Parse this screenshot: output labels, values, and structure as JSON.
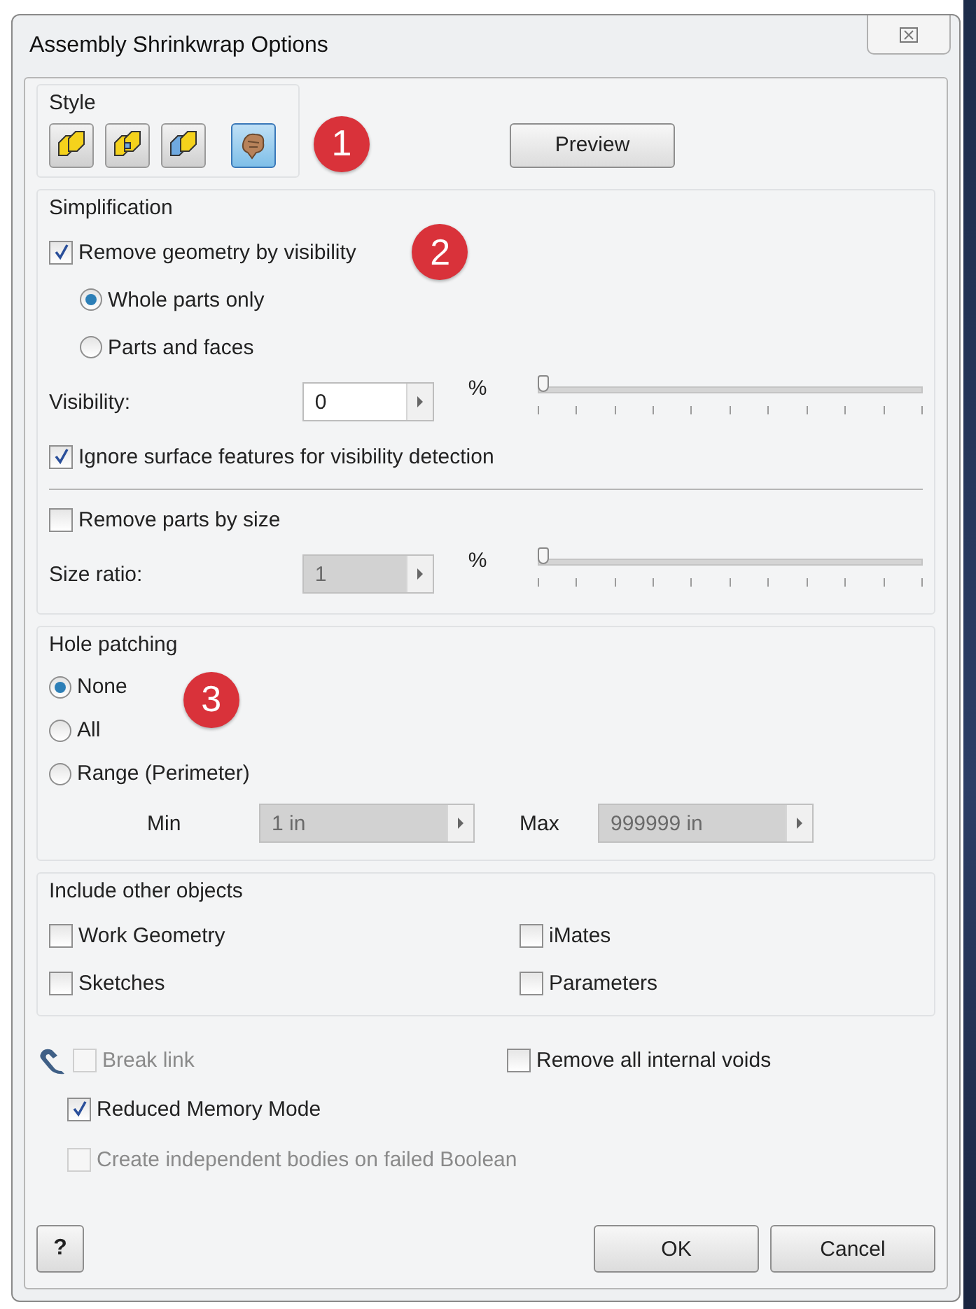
{
  "window": {
    "title": "Assembly Shrinkwrap Options"
  },
  "style": {
    "label": "Style",
    "options": [
      {
        "selected": false
      },
      {
        "selected": false
      },
      {
        "selected": false
      },
      {
        "selected": true
      }
    ],
    "badge": "1",
    "preview": "Preview"
  },
  "simplification": {
    "label": "Simplification",
    "remove_by_visibility": {
      "label": "Remove geometry by visibility",
      "checked": true
    },
    "badge": "2",
    "mode": [
      {
        "label": "Whole parts only",
        "selected": true
      },
      {
        "label": "Parts and faces",
        "selected": false
      }
    ],
    "visibility": {
      "label": "Visibility:",
      "value": "0",
      "unit": "%",
      "disabled": false,
      "level": 0
    },
    "ignore_surface": {
      "label": "Ignore surface features for visibility detection",
      "checked": true
    },
    "remove_by_size": {
      "label": "Remove parts by size",
      "checked": false
    },
    "size_ratio": {
      "label": "Size ratio:",
      "value": "1",
      "unit": "%",
      "disabled": true,
      "level": 0
    }
  },
  "hole_patching": {
    "label": "Hole patching",
    "badge": "3",
    "options": [
      {
        "label": "None",
        "selected": true
      },
      {
        "label": "All",
        "selected": false
      },
      {
        "label": "Range (Perimeter)",
        "selected": false
      }
    ],
    "min": {
      "label": "Min",
      "value": "1 in",
      "disabled": true
    },
    "max": {
      "label": "Max",
      "value": "999999 in",
      "disabled": true
    }
  },
  "include_other_objects": {
    "label": "Include other objects",
    "items": [
      {
        "label": "Work Geometry",
        "checked": false
      },
      {
        "label": "iMates",
        "checked": false
      },
      {
        "label": "Sketches",
        "checked": false
      },
      {
        "label": "Parameters",
        "checked": false
      }
    ]
  },
  "options": {
    "break_link": {
      "label": "Break link",
      "checked": false,
      "disabled": true
    },
    "remove_voids": {
      "label": "Remove all internal voids",
      "checked": false,
      "disabled": false
    },
    "reduced_memory": {
      "label": "Reduced Memory Mode",
      "checked": true,
      "disabled": false
    },
    "independent_bodies": {
      "label": "Create independent bodies on failed Boolean",
      "checked": false,
      "disabled": true
    }
  },
  "help": "?",
  "buttons": [
    {
      "label": "OK"
    },
    {
      "label": "Cancel"
    }
  ]
}
